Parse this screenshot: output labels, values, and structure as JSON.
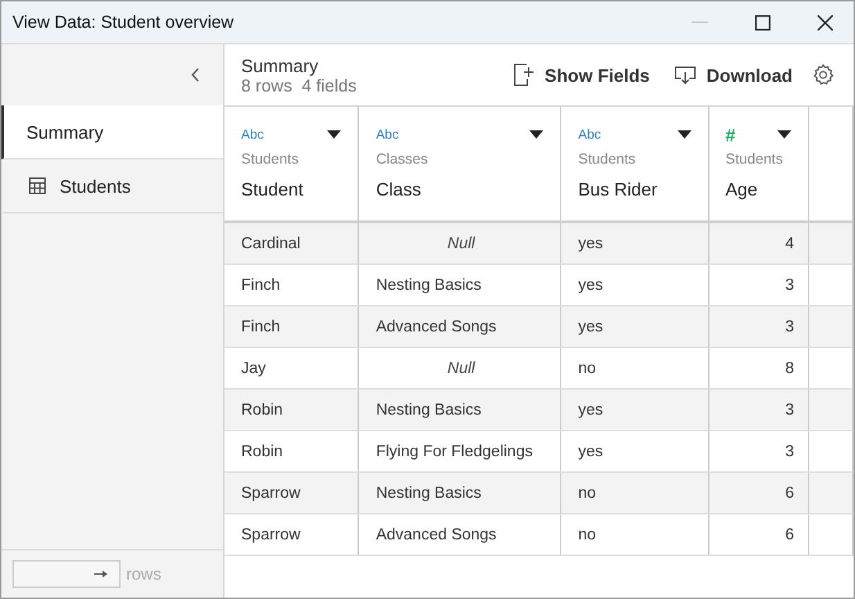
{
  "window": {
    "title": "View Data: Student overview"
  },
  "sidebar": {
    "items": [
      {
        "label": "Summary",
        "kind": "summary",
        "selected": true
      },
      {
        "label": "Students",
        "kind": "table",
        "selected": false
      }
    ],
    "rows_label": "rows"
  },
  "summary": {
    "title": "Summary",
    "counts": "8 rows  4 fields"
  },
  "toolbar": {
    "buttons": [
      {
        "label": "Show Fields",
        "kind": "fields"
      },
      {
        "label": "Download",
        "kind": "download"
      }
    ]
  },
  "table": {
    "columns": [
      {
        "type_label": "Abc",
        "kind": "string",
        "source": "Students",
        "name": "Student"
      },
      {
        "type_label": "Abc",
        "kind": "string",
        "source": "Classes",
        "name": "Class"
      },
      {
        "type_label": "Abc",
        "kind": "string",
        "source": "Students",
        "name": "Bus Rider"
      },
      {
        "type_label": "#",
        "kind": "number",
        "source": "Students",
        "name": "Age"
      }
    ],
    "rows": [
      [
        "Cardinal",
        {
          "null": "Null"
        },
        "yes",
        "4"
      ],
      [
        "Finch",
        "Nesting Basics",
        "yes",
        "3"
      ],
      [
        "Finch",
        "Advanced Songs",
        "yes",
        "3"
      ],
      [
        "Jay",
        {
          "null": "Null"
        },
        "no",
        "8"
      ],
      [
        "Robin",
        "Nesting Basics",
        "yes",
        "3"
      ],
      [
        "Robin",
        "Flying For Fledgelings",
        "yes",
        "3"
      ],
      [
        "Sparrow",
        "Nesting Basics",
        "no",
        "6"
      ],
      [
        "Sparrow",
        "Advanced Songs",
        "no",
        "6"
      ]
    ]
  }
}
